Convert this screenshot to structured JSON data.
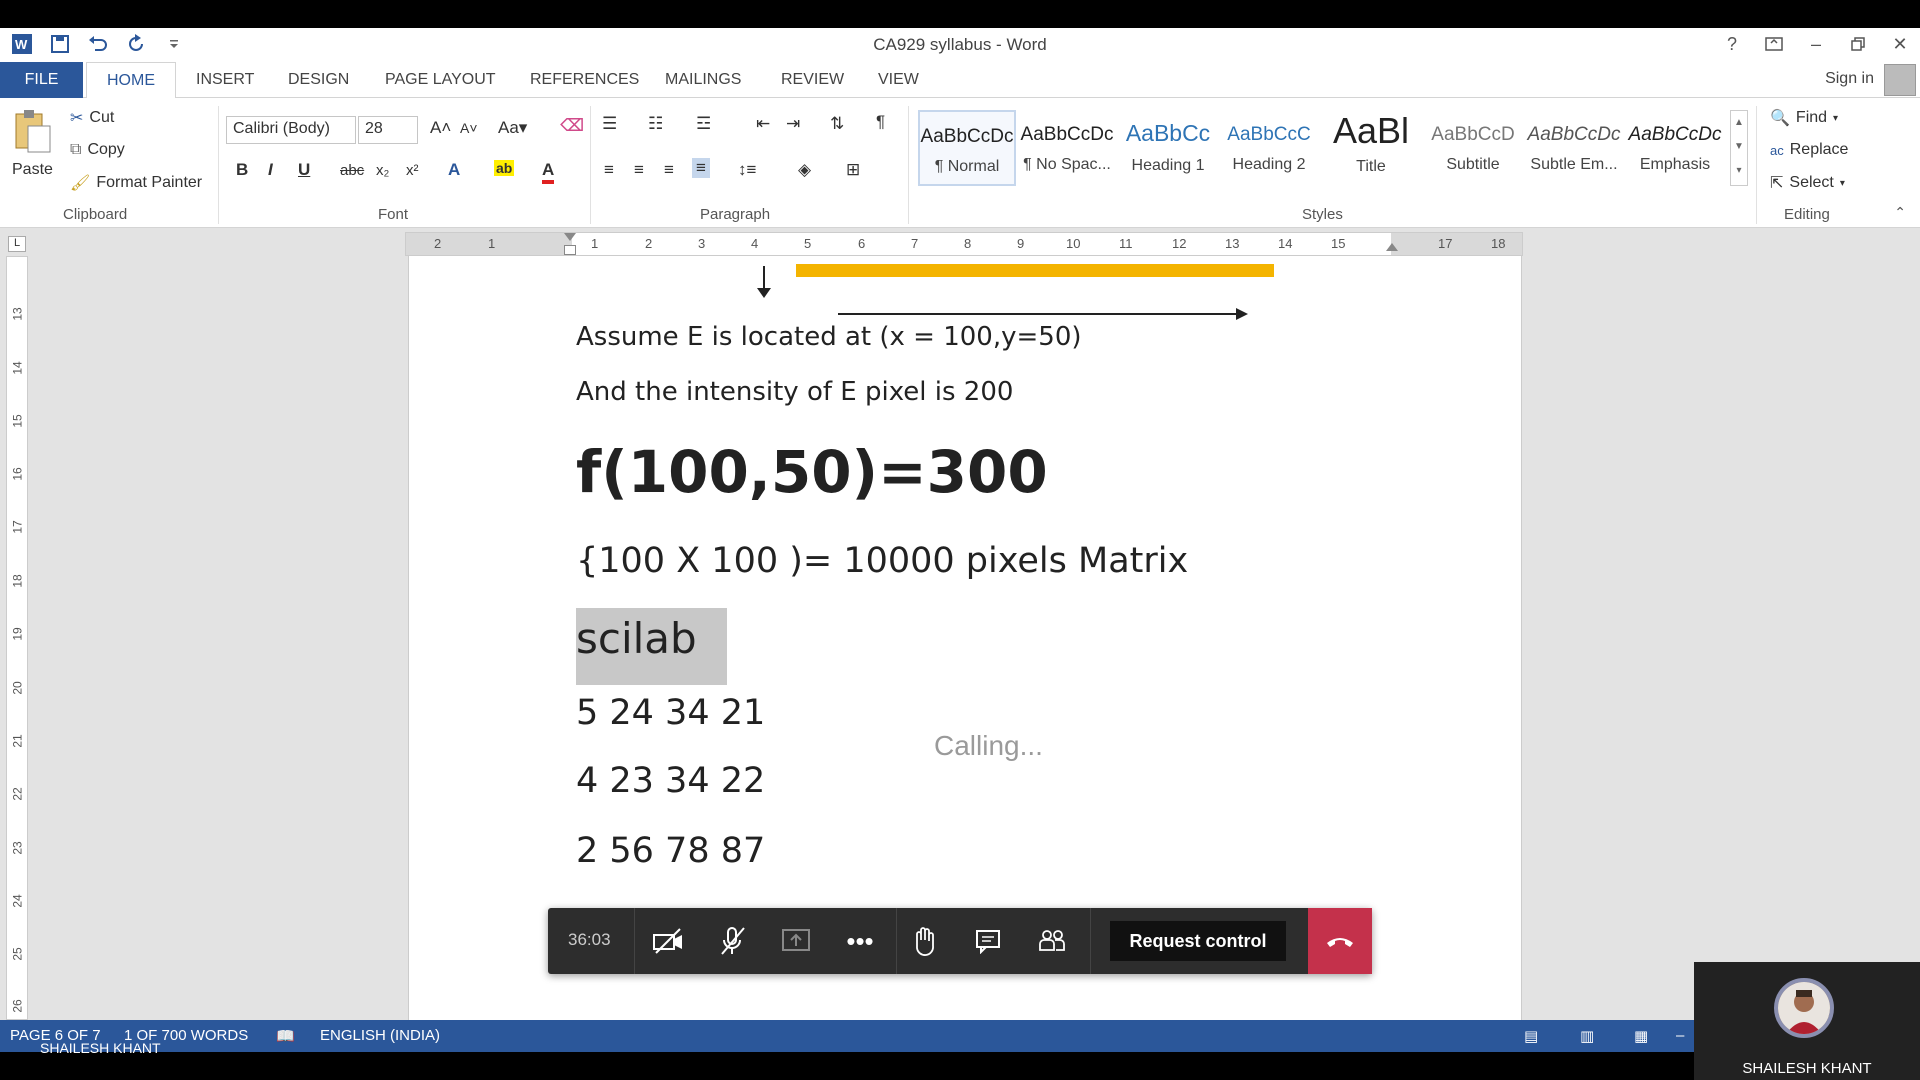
{
  "window": {
    "title": "CA929 syllabus - Word"
  },
  "tabs": [
    "FILE",
    "HOME",
    "INSERT",
    "DESIGN",
    "PAGE LAYOUT",
    "REFERENCES",
    "MAILINGS",
    "REVIEW",
    "VIEW"
  ],
  "account": {
    "signin": "Sign in"
  },
  "clipboard": {
    "paste": "Paste",
    "cut": "Cut",
    "copy": "Copy",
    "format_painter": "Format Painter",
    "label": "Clipboard"
  },
  "font": {
    "name": "Calibri (Body)",
    "size": "28",
    "label": "Font"
  },
  "paragraph": {
    "label": "Paragraph"
  },
  "styles": {
    "label": "Styles",
    "items": [
      {
        "sample": "AaBbCcDc",
        "name": "¶ Normal"
      },
      {
        "sample": "AaBbCcDc",
        "name": "¶ No Spac..."
      },
      {
        "sample": "AaBbCc",
        "name": "Heading 1"
      },
      {
        "sample": "AaBbCcC",
        "name": "Heading 2"
      },
      {
        "sample": "AaBl",
        "name": "Title"
      },
      {
        "sample": "AaBbCcD",
        "name": "Subtitle"
      },
      {
        "sample": "AaBbCcDc",
        "name": "Subtle Em..."
      },
      {
        "sample": "AaBbCcDc",
        "name": "Emphasis"
      }
    ]
  },
  "editing": {
    "find": "Find",
    "replace": "Replace",
    "select": "Select",
    "label": "Editing"
  },
  "ruler": {
    "h": [
      "2",
      "1",
      "1",
      "2",
      "3",
      "4",
      "5",
      "6",
      "7",
      "8",
      "9",
      "10",
      "11",
      "12",
      "13",
      "14",
      "15",
      "17",
      "18"
    ],
    "v": [
      "13",
      "14",
      "15",
      "16",
      "17",
      "18",
      "19",
      "20",
      "21",
      "22",
      "23",
      "24",
      "25",
      "26"
    ]
  },
  "document": {
    "line1": "Assume E is located at (x = 100,y=50)",
    "line2": "And the intensity of E pixel is 200",
    "line3": "f(100,50)=300",
    "line4": "{100 X 100 )= 10000 pixels Matrix",
    "line5": "scilab",
    "line6": "5 24 34 21",
    "line7": "4 23 34 22",
    "line8": "2 56 78 87"
  },
  "call": {
    "status": "Calling...",
    "timer": "36:03",
    "request_control": "Request control",
    "participant": "SHAILESH KHANT",
    "overlay_name": "SHAILESH KHANT"
  },
  "statusbar": {
    "page": "PAGE 6 OF 7",
    "words": "1 OF 700 WORDS",
    "language": "ENGLISH (INDIA)"
  }
}
